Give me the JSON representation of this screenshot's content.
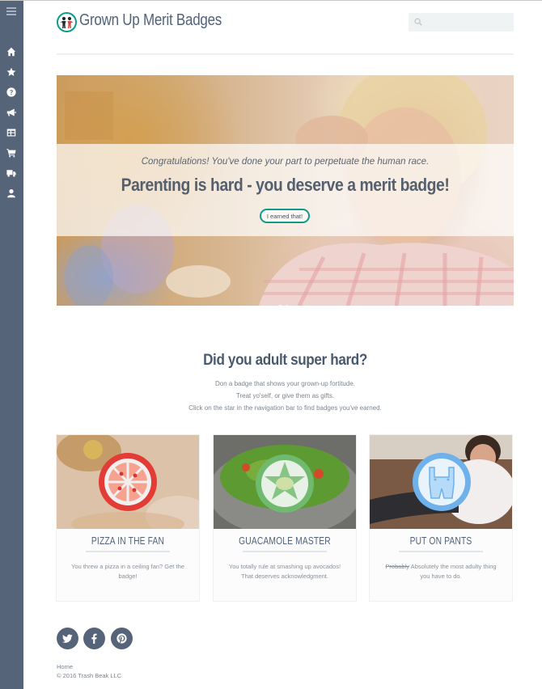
{
  "site": {
    "title": "Grown Up Merit Badges"
  },
  "search": {
    "placeholder": ""
  },
  "sidebar": {
    "items": [
      {
        "icon": "home-icon"
      },
      {
        "icon": "star-icon"
      },
      {
        "icon": "question-icon"
      },
      {
        "icon": "bullhorn-icon"
      },
      {
        "icon": "table-icon"
      },
      {
        "icon": "cart-icon"
      },
      {
        "icon": "truck-icon"
      },
      {
        "icon": "user-icon"
      }
    ]
  },
  "hero": {
    "subtitle": "Congratulations! You've done your part to perpetuate the human race.",
    "title": "Parenting is hard - you deserve a merit badge!",
    "button": "I earned that!"
  },
  "intro": {
    "heading": "Did you adult super hard?",
    "lines": [
      "Don a badge that shows your grown-up fortitude.",
      "Treat yo'self, or give them as gifts.",
      "Click on the star in the navigation bar to find badges you've earned."
    ]
  },
  "cards": [
    {
      "title": "PIZZA IN THE FAN",
      "text": "You threw a pizza in a ceiling fan? Get the badge!",
      "strike": ""
    },
    {
      "title": "GUACAMOLE MASTER",
      "text": "You totally rule at smashing up avocados! That deserves acknowledgment.",
      "strike": ""
    },
    {
      "title": "PUT ON PANTS",
      "strike": "Probably",
      "text": " Absolutely the most adulty thing you have to do."
    }
  ],
  "footer": {
    "link": "Home",
    "copyright": "© 2016 Trash Beak LLC"
  },
  "colors": {
    "accent": "#0f9b8c",
    "sidebar": "#556479",
    "text": "#4a5a6e"
  }
}
